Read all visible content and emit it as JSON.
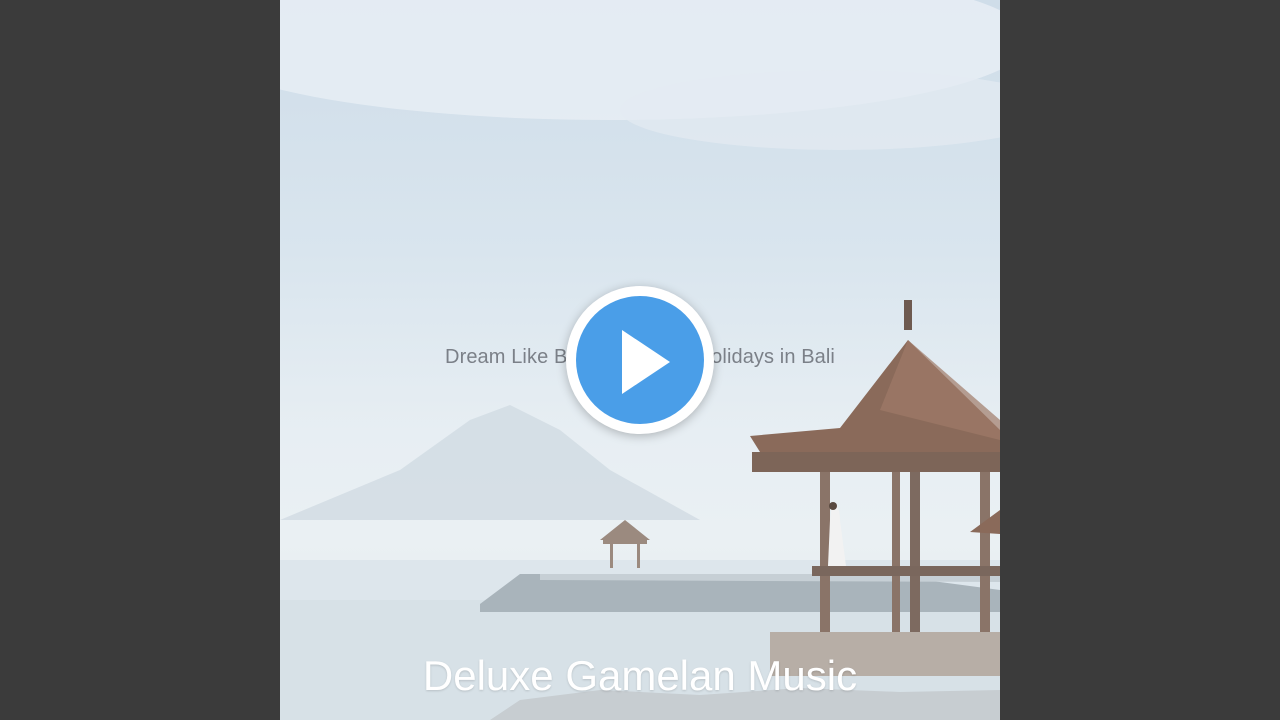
{
  "album_cover": {
    "track_title": "Dream Like Background for Holidays in Bali",
    "artist": "Deluxe Gamelan Music"
  },
  "player": {
    "play_icon": "play-icon",
    "accent_color": "#4a9ee8"
  },
  "colors": {
    "letterbox": "#3b3b3b",
    "title_text": "#7b8088",
    "artist_text": "#ffffff"
  }
}
